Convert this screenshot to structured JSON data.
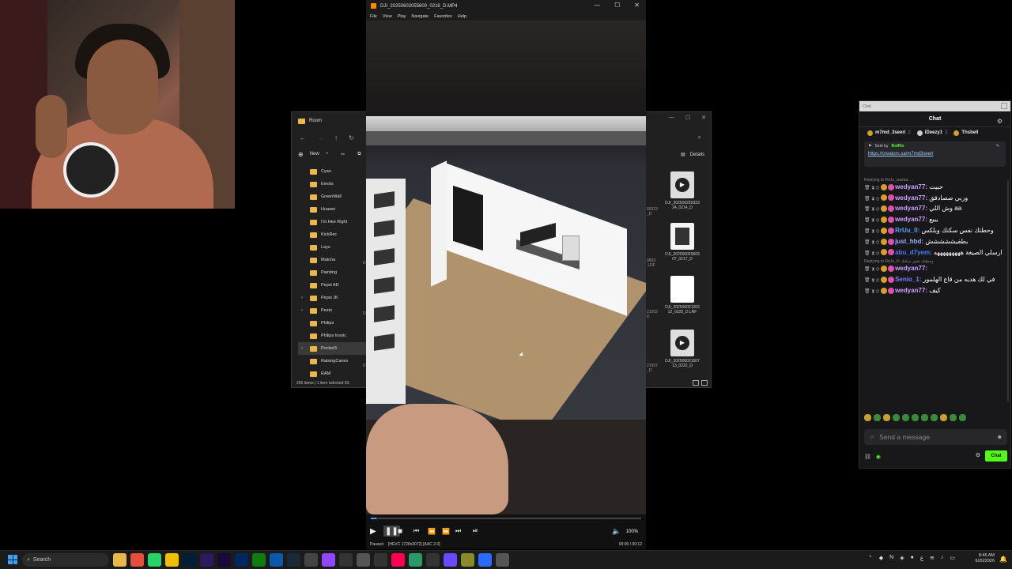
{
  "explorer": {
    "title": "Room",
    "new_label": "New",
    "details_label": "Details",
    "tree": [
      {
        "label": "Cyan",
        "expandable": false
      },
      {
        "label": "Emots",
        "expandable": false
      },
      {
        "label": "GreenWall",
        "expandable": false
      },
      {
        "label": "Huawei",
        "expandable": false
      },
      {
        "label": "I'm Hee Right",
        "expandable": false
      },
      {
        "label": "KickRec",
        "expandable": false
      },
      {
        "label": "Lays",
        "expandable": false
      },
      {
        "label": "Matcha",
        "expandable": false
      },
      {
        "label": "Painting",
        "expandable": false
      },
      {
        "label": "Pepsi AD",
        "expandable": false
      },
      {
        "label": "Pepsi JK",
        "expandable": true
      },
      {
        "label": "Pesto",
        "expandable": true
      },
      {
        "label": "Philips",
        "expandable": false
      },
      {
        "label": "Philips Invoic",
        "expandable": false
      },
      {
        "label": "Pocket3",
        "expandable": true,
        "selected": true
      },
      {
        "label": "RaisingCanes",
        "expandable": false
      },
      {
        "label": "RAM",
        "expandable": false
      }
    ],
    "status": "256 items  |  1 item selected  93.",
    "files_right": [
      {
        "name": "DJI_202506250323\n24_0214_D",
        "type": "video"
      },
      {
        "name": "DJI_202506020603\n07_0217_D",
        "type": "image"
      },
      {
        "name": "DJI_202506021203\n12_0220_D.LRF",
        "type": "doc"
      },
      {
        "name": "DJI_202506031507\n13_0222_D",
        "type": "video"
      }
    ],
    "files_left_fragments": [
      "50323",
      "_D",
      "0603",
      ".LRF",
      "21202",
      "D",
      "21507",
      "_D"
    ]
  },
  "player": {
    "title": "DJI_20250602055600_0216_D.MP4",
    "menu": [
      "File",
      "View",
      "Play",
      "Navigate",
      "Favorites",
      "Help"
    ],
    "status_paused": "Paused",
    "status_codec": "[HEVC 1728x3072]  [AAC 2.0]",
    "time": "00:00 / 00:12",
    "volume": "100%",
    "progress": 0.02
  },
  "chat": {
    "window_title": "Chat",
    "header": "Chat",
    "gifters": [
      {
        "name": "m7md_3seeri",
        "count": "2",
        "color": "#d4a02a"
      },
      {
        "name": "iDeezy1",
        "count": "2",
        "color": "#cccccc"
      },
      {
        "name": "Thsbell",
        "count": "",
        "color": "#d4a02a"
      }
    ],
    "pinned": {
      "sent_by": "Sent by",
      "bot": "BotRix",
      "link": "https://creators.sa/m7md3seeri"
    },
    "messages": [
      {
        "reply": "Replying to RrUu_wazaa: ...",
        "user": "wedyan77:",
        "user_color": "#c8a0ff",
        "text": "حبيت"
      },
      {
        "reply": "",
        "user": "wedyan77:",
        "user_color": "#c8a0ff",
        "text": "وربي صصادقق"
      },
      {
        "reply": "",
        "user": "wedyan77:",
        "user_color": "#c8a0ff",
        "text": "وش اللي aa"
      },
      {
        "reply": "",
        "user": "wedyan77:",
        "user_color": "#c8a0ff",
        "text": "يبيع"
      },
      {
        "reply": "",
        "user": "RrUu_0:",
        "user_color": "#4aa8ff",
        "text": "وحطتك نفس سكنك وبلكس"
      },
      {
        "reply": "",
        "user": "just_hbd:",
        "user_color": "#9ab0ff",
        "text": "بطفيششششش"
      },
      {
        "reply": "",
        "user": "abu_d7yem:",
        "user_color": "#4a7aff",
        "text": "ارسلي الصيغة هههههههههه"
      },
      {
        "reply": "Replying to RrUu_0: وحطتك نفس سكنك",
        "user": "wedyan77:",
        "user_color": "#c8a0ff",
        "text": ""
      },
      {
        "reply": "",
        "user": "Senio_1:",
        "user_color": "#7a7aff",
        "text": "في لك هديه من قاع الهلمور"
      },
      {
        "reply": "",
        "user": "wedyan77:",
        "user_color": "#c8a0ff",
        "text": "كيف"
      }
    ],
    "input_placeholder": "Send a message",
    "chat_button": "Chat"
  },
  "taskbar": {
    "search": "Search",
    "time": "8:46 AM",
    "date": "6/20/2026"
  }
}
